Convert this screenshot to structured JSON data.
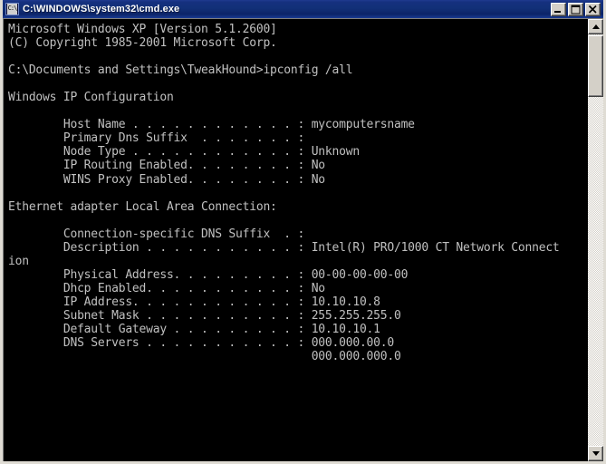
{
  "window": {
    "title": "C:\\WINDOWS\\system32\\cmd.exe",
    "icon_name": "cmd-icon",
    "icon_glyph": "C:\\",
    "titlebar_color": "#123078",
    "frame_color": "#d4d0c8",
    "buttons": {
      "minimize": "Minimize",
      "maximize": "Maximize",
      "close": "Close"
    }
  },
  "console": {
    "background": "#000000",
    "foreground": "#c0c0c0",
    "text": "Microsoft Windows XP [Version 5.1.2600]\n(C) Copyright 1985-2001 Microsoft Corp.\n\nC:\\Documents and Settings\\TweakHound>ipconfig /all\n\nWindows IP Configuration\n\n        Host Name . . . . . . . . . . . . : mycomputersname\n        Primary Dns Suffix  . . . . . . . :\n        Node Type . . . . . . . . . . . . : Unknown\n        IP Routing Enabled. . . . . . . . : No\n        WINS Proxy Enabled. . . . . . . . : No\n\nEthernet adapter Local Area Connection:\n\n        Connection-specific DNS Suffix  . :\n        Description . . . . . . . . . . . : Intel(R) PRO/1000 CT Network Connect\nion\n        Physical Address. . . . . . . . . : 00-00-00-00-00\n        Dhcp Enabled. . . . . . . . . . . : No\n        IP Address. . . . . . . . . . . . : 10.10.10.8\n        Subnet Mask . . . . . . . . . . . : 255.255.255.0\n        Default Gateway . . . . . . . . . : 10.10.10.1\n        DNS Servers . . . . . . . . . . . : 000.000.00.0\n                                            000.000.000.0",
    "command": "ipconfig /all",
    "prompt": "C:\\Documents and Settings\\TweakHound>",
    "os_banner": "Microsoft Windows XP [Version 5.1.2600]",
    "copyright": "(C) Copyright 1985-2001 Microsoft Corp.",
    "sections": [
      {
        "heading": "Windows IP Configuration",
        "entries": [
          {
            "label": "Host Name",
            "value": "mycomputersname"
          },
          {
            "label": "Primary Dns Suffix",
            "value": ""
          },
          {
            "label": "Node Type",
            "value": "Unknown"
          },
          {
            "label": "IP Routing Enabled.",
            "value": "No"
          },
          {
            "label": "WINS Proxy Enabled.",
            "value": "No"
          }
        ]
      },
      {
        "heading": "Ethernet adapter Local Area Connection:",
        "entries": [
          {
            "label": "Connection-specific DNS Suffix",
            "value": ""
          },
          {
            "label": "Description",
            "value": "Intel(R) PRO/1000 CT Network Connection"
          },
          {
            "label": "Physical Address.",
            "value": "00-00-00-00-00"
          },
          {
            "label": "Dhcp Enabled.",
            "value": "No"
          },
          {
            "label": "IP Address.",
            "value": "10.10.10.8"
          },
          {
            "label": "Subnet Mask",
            "value": "255.255.255.0"
          },
          {
            "label": "Default Gateway",
            "value": "10.10.10.1"
          },
          {
            "label": "DNS Servers",
            "value": "000.000.00.0"
          },
          {
            "label": "",
            "value": "000.000.000.0"
          }
        ]
      }
    ]
  },
  "scrollbar": {
    "up_arrow": "Scroll up",
    "down_arrow": "Scroll down",
    "thumb": "Scroll thumb",
    "track": "Scroll track"
  }
}
